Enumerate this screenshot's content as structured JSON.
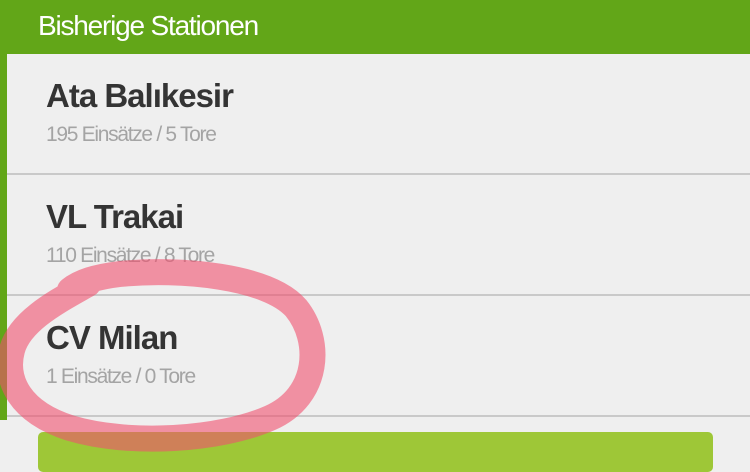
{
  "header": {
    "title": "Bisherige Stationen"
  },
  "stations": [
    {
      "name": "Ata Balıkesir",
      "stats": "195 Einsätze / 5 Tore"
    },
    {
      "name": "VL Trakai",
      "stats": "110 Einsätze / 8 Tore"
    },
    {
      "name": "CV Milan",
      "stats": "1 Einsätze / 0 Tore"
    }
  ],
  "colors": {
    "header_green": "#62a618",
    "button_green": "#9ec737",
    "highlight_red": "#f0506e"
  }
}
